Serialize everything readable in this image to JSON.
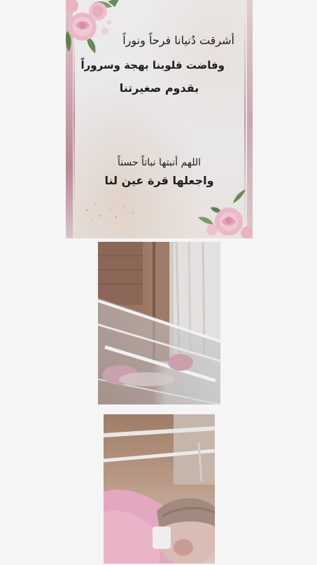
{
  "card": {
    "line1": "أشرقت دُنيانا فرحاً ونوراً",
    "line2": "وفاضت قلوبنا بهجة وسروراً",
    "line3": "بقدوم صغيرتنا",
    "line4": "اللهم أنبتها نباتاً حسناً",
    "line5": "واجعلها قرة عين لنا"
  },
  "colors": {
    "page_background": "#f5f5f6",
    "card_background": "#ebeaeb",
    "rose_pink": "#e9b6c4",
    "leaf_green": "#6c8a57",
    "text": "#1d1d1d"
  },
  "icons": {
    "flowers": "rose-bouquet-icon"
  }
}
